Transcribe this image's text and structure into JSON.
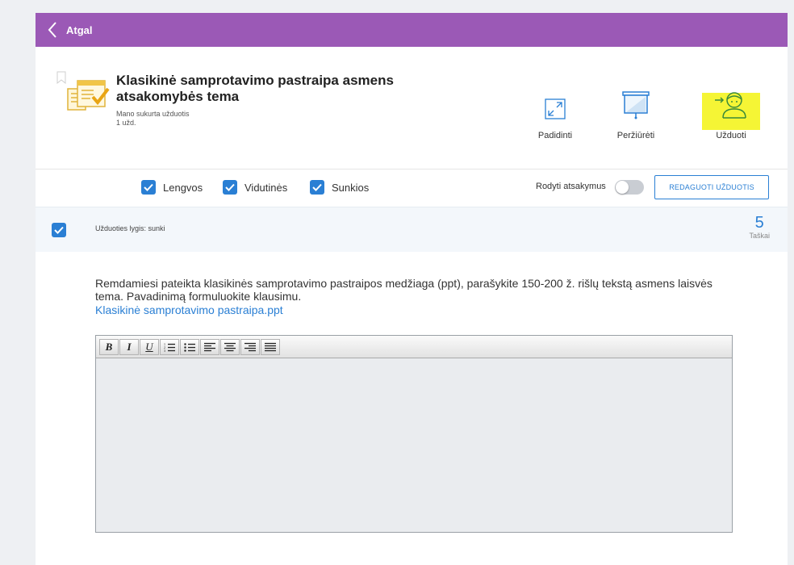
{
  "topbar": {
    "back_label": "Atgal",
    "color": "#9b59b6"
  },
  "header": {
    "title": "Klasikinė samprotavimo pastraipa asmens atsakomybės tema",
    "subtitle": "Mano sukurta užduotis",
    "count": "1 užd."
  },
  "actions": {
    "enlarge": "Padidinti",
    "preview": "Peržiūrėti",
    "tasks": "Užduoti"
  },
  "filters": {
    "easy": "Lengvos",
    "medium": "Vidutinės",
    "hard": "Sunkios",
    "show_answers": "Rodyti atsakymus",
    "edit_button": "REDAGUOTI UŽDUOTIS"
  },
  "task": {
    "level": "Užduoties lygis: sunki",
    "points": "5",
    "points_label": "Taškai",
    "question": "Remdamiesi pateikta klasikinės samprotavimo pastraipos medžiaga (ppt), parašykite 150-200 ž. rišlų tekstą asmens laisvės tema. Pavadinimą formuluokite klausimu.",
    "link": "Klasikinė samprotavimo pastraipa.ppt"
  },
  "editor": {
    "tools": [
      "bold-icon",
      "italic-icon",
      "underline-icon",
      "ordered-list-icon",
      "unordered-list-icon",
      "align-left-icon",
      "align-center-icon",
      "align-right-icon",
      "align-justify-icon"
    ]
  },
  "colors": {
    "accent": "#2a7fd4",
    "highlight": "#f5f535"
  }
}
